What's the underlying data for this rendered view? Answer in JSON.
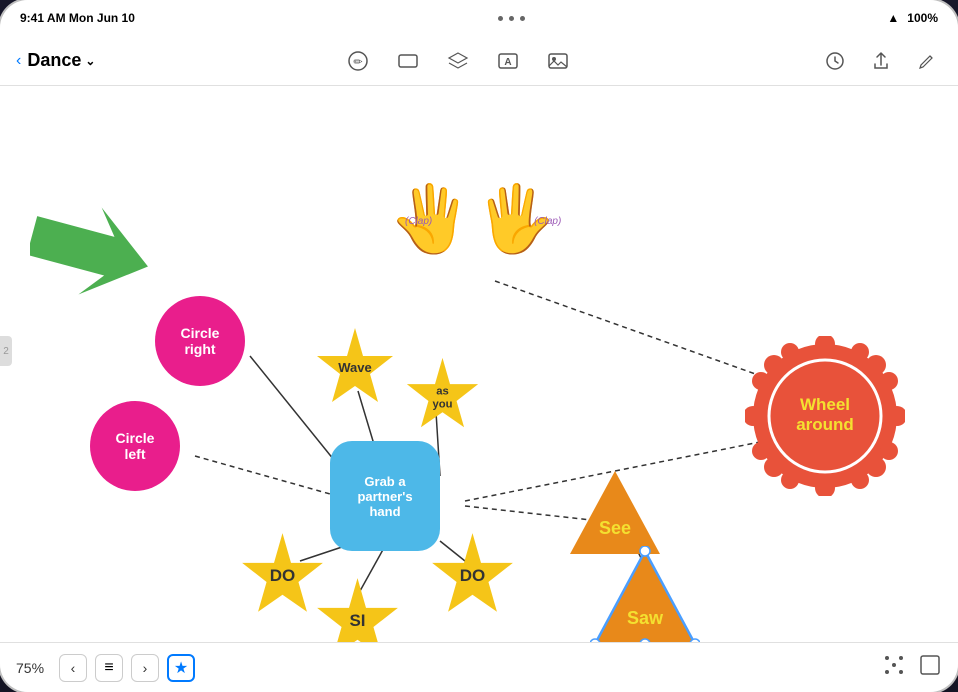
{
  "statusBar": {
    "time": "9:41 AM  Mon Jun 10",
    "dots": 3,
    "wifi": "▲",
    "battery": "100%"
  },
  "toolbar": {
    "backLabel": "‹",
    "title": "Dance",
    "titleDropdown": "⌄",
    "icons": [
      "pencil-circle",
      "rectangle",
      "layers",
      "text",
      "image"
    ],
    "rightIcons": [
      "clock",
      "share",
      "edit"
    ]
  },
  "bottomBar": {
    "zoomLevel": "75%",
    "prevLabel": "‹",
    "nextLabel": "›"
  },
  "canvas": {
    "nodes": [
      {
        "id": "circle-right",
        "label": "Circle\nright",
        "shape": "circle",
        "color": "#E91E8C",
        "textColor": "white"
      },
      {
        "id": "circle-left",
        "label": "Circle\nleft",
        "shape": "circle",
        "color": "#E91E8C",
        "textColor": "white"
      },
      {
        "id": "center",
        "label": "Grab a\npartner's\nhand",
        "shape": "rounded-square",
        "color": "#4DB8E8",
        "textColor": "white"
      },
      {
        "id": "wave",
        "label": "Wave",
        "shape": "star4",
        "color": "#F5C518",
        "textColor": "#333"
      },
      {
        "id": "as-you",
        "label": "as\nyou",
        "shape": "star4",
        "color": "#F5C518",
        "textColor": "#333"
      },
      {
        "id": "do1",
        "label": "DO",
        "shape": "star4",
        "color": "#F5C518",
        "textColor": "#333"
      },
      {
        "id": "si",
        "label": "SI",
        "shape": "star4",
        "color": "#F5C518",
        "textColor": "#333"
      },
      {
        "id": "do2",
        "label": "DO",
        "shape": "star4",
        "color": "#F5C518",
        "textColor": "#333"
      },
      {
        "id": "wheel-around",
        "label": "Wheel\naround",
        "shape": "sunburst",
        "bgColor": "#E8523A",
        "textColor": "#F4E030"
      },
      {
        "id": "see",
        "label": "See",
        "shape": "triangle",
        "color": "#E8891A",
        "textColor": "#F4E030"
      },
      {
        "id": "saw",
        "label": "Saw",
        "shape": "triangle",
        "color": "#E8891A",
        "textColor": "#F4E030"
      },
      {
        "id": "clap1",
        "label": "(Clap)",
        "shape": "hand",
        "color": "#7B2FBE"
      },
      {
        "id": "clap2",
        "label": "(Clap)",
        "shape": "hand",
        "color": "#7B2FBE"
      }
    ]
  }
}
